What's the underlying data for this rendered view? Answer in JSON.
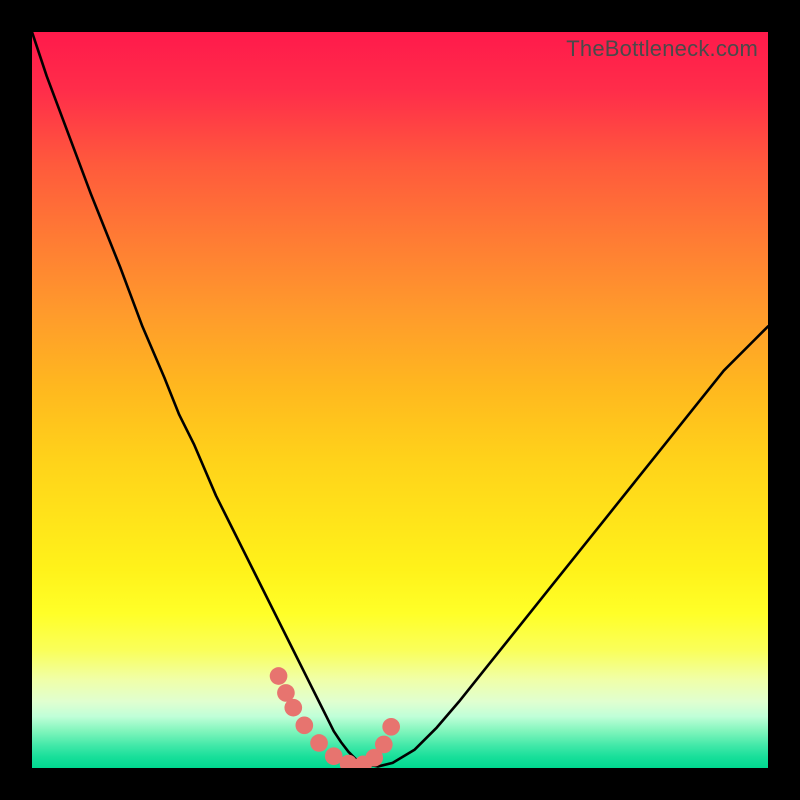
{
  "watermark": "TheBottleneck.com",
  "chart_data": {
    "type": "line",
    "title": "",
    "xlabel": "",
    "ylabel": "",
    "xlim": [
      0,
      100
    ],
    "ylim": [
      0,
      100
    ],
    "grid": false,
    "legend": false,
    "series": [
      {
        "name": "bottleneck-curve",
        "color": "#000000",
        "x": [
          0,
          2,
          5,
          8,
          10,
          12,
          15,
          18,
          20,
          22,
          25,
          27,
          29,
          31,
          33,
          35,
          37,
          38,
          39,
          40,
          41,
          42,
          43,
          44,
          45,
          47,
          49,
          52,
          55,
          58,
          62,
          66,
          70,
          74,
          78,
          82,
          86,
          90,
          94,
          98,
          100
        ],
        "y": [
          100,
          94,
          86,
          78,
          73,
          68,
          60,
          53,
          48,
          44,
          37,
          33,
          29,
          25,
          21,
          17,
          13,
          11,
          9,
          7,
          5,
          3.5,
          2.2,
          1.2,
          0.6,
          0.2,
          0.7,
          2.5,
          5.5,
          9,
          14,
          19,
          24,
          29,
          34,
          39,
          44,
          49,
          54,
          58,
          60
        ]
      }
    ],
    "markers": {
      "name": "trough-dots",
      "color": "#e7746f",
      "radius_pct": 1.2,
      "x": [
        33.5,
        34.5,
        35.5,
        37,
        39,
        41,
        43,
        45,
        46.5,
        47.8,
        48.8
      ],
      "y": [
        12.5,
        10.2,
        8.2,
        5.8,
        3.4,
        1.6,
        0.6,
        0.5,
        1.4,
        3.2,
        5.6
      ]
    }
  }
}
